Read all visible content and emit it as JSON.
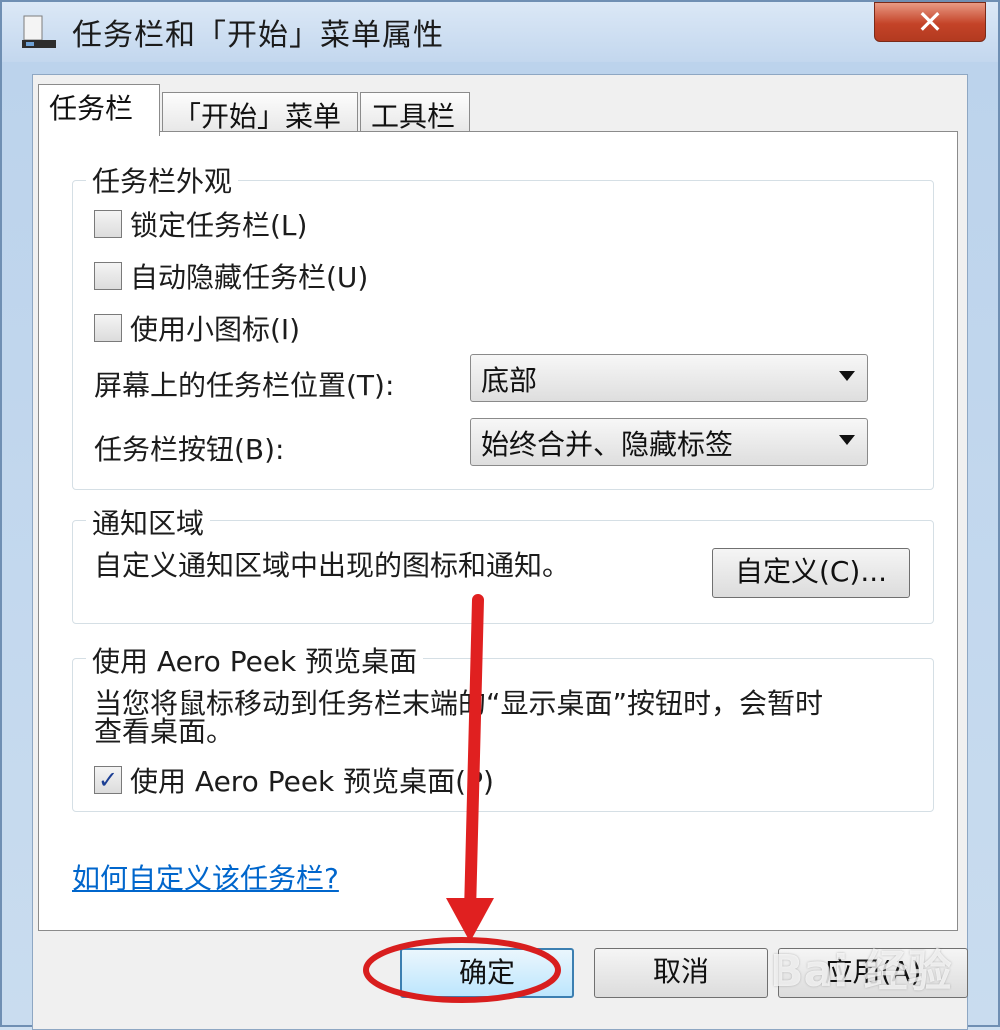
{
  "window": {
    "title": "任务栏和「开始」菜单属性",
    "close_glyph": "✕"
  },
  "tabs": [
    {
      "label": "任务栏",
      "active": true
    },
    {
      "label": "「开始」菜单",
      "active": false
    },
    {
      "label": "工具栏",
      "active": false
    }
  ],
  "appearance": {
    "title": "任务栏外观",
    "lock_label": "锁定任务栏(L)",
    "lock_checked": false,
    "autohide_label": "自动隐藏任务栏(U)",
    "autohide_checked": false,
    "small_icons_label": "使用小图标(I)",
    "small_icons_checked": false,
    "location_label": "屏幕上的任务栏位置(T):",
    "location_value": "底部",
    "buttons_label": "任务栏按钮(B):",
    "buttons_value": "始终合并、隐藏标签"
  },
  "notification": {
    "title": "通知区域",
    "description": "自定义通知区域中出现的图标和通知。",
    "customize_label": "自定义(C)..."
  },
  "aero_peek": {
    "title": "使用 Aero Peek 预览桌面",
    "description_line1": "当您将鼠标移动到任务栏末端的“显示桌面”按钮时，会暂时",
    "description_line2": "查看桌面。",
    "use_label": "使用 Aero Peek 预览桌面(P)",
    "use_checked": true,
    "check_glyph": "✓"
  },
  "help_link": "如何自定义该任务栏?",
  "footer": {
    "ok_label": "确定",
    "cancel_label": "取消",
    "apply_label": "应用(A)"
  },
  "watermark": "Bai 经验",
  "annotation": {
    "arrow_color": "#e02020",
    "circle_color": "#d81e1e"
  }
}
